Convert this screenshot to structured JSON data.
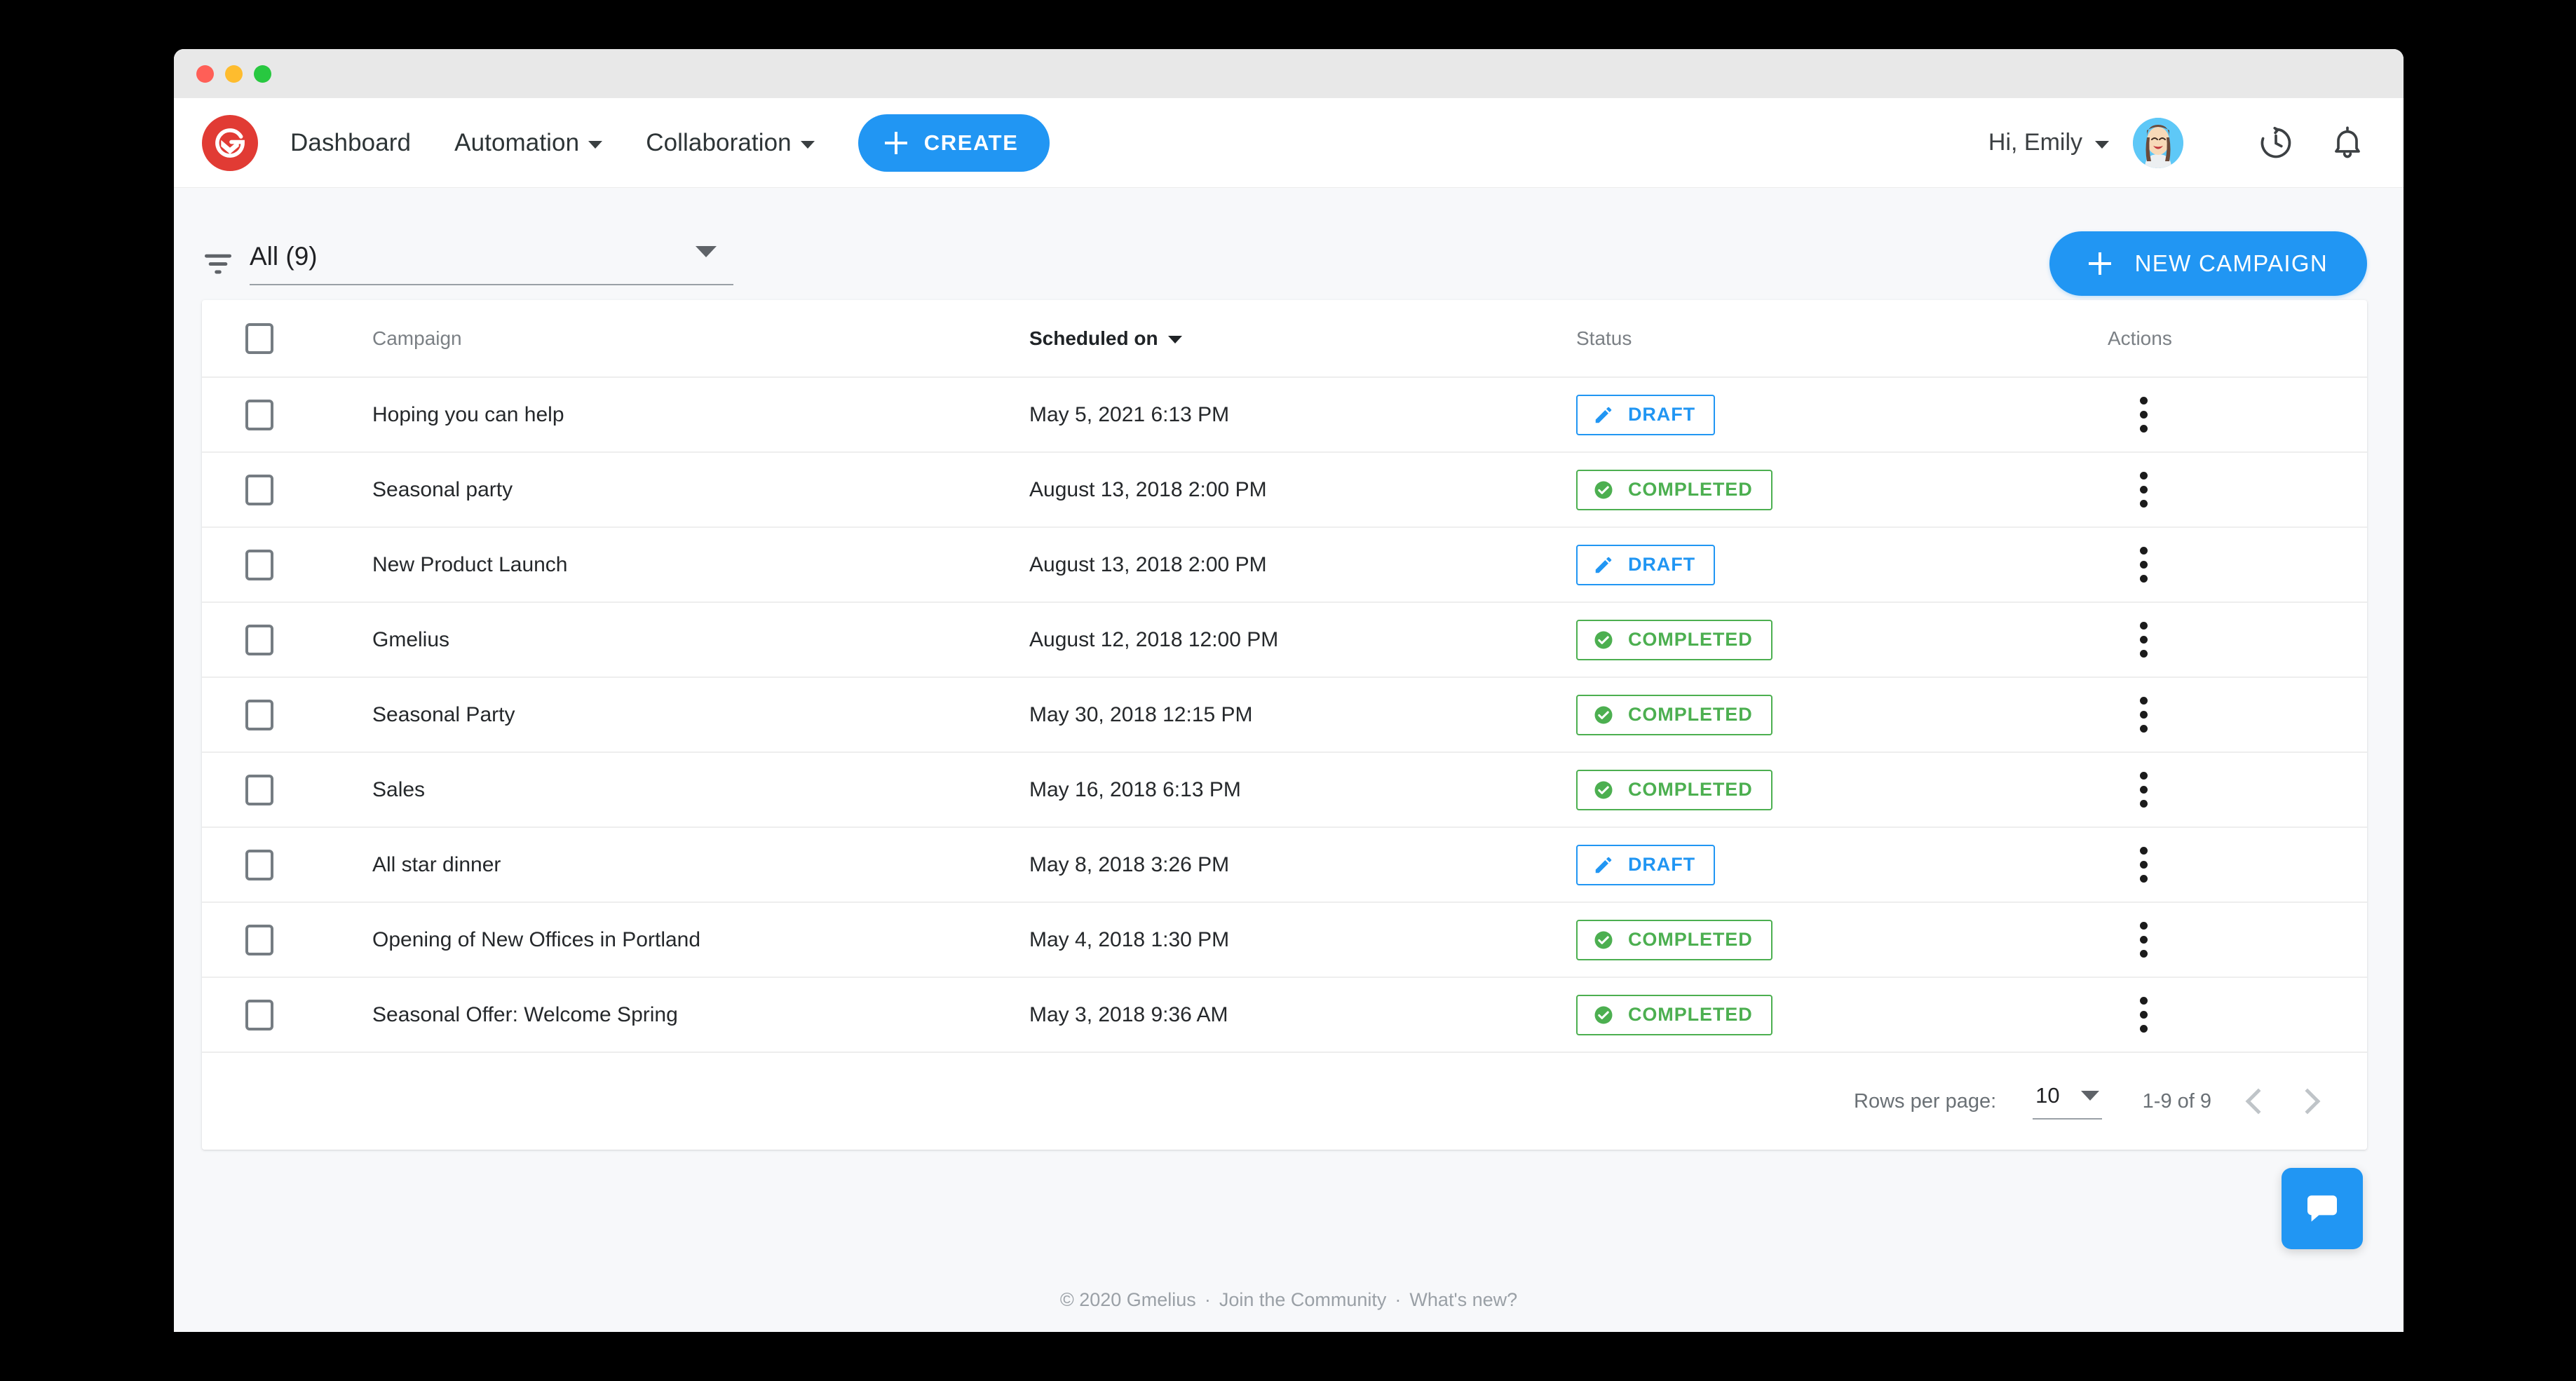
{
  "window": {
    "traffic_lights": [
      "close",
      "minimize",
      "maximize"
    ]
  },
  "navbar": {
    "logo_name": "gmelius-logo",
    "links": [
      {
        "label": "Dashboard",
        "has_dropdown": false
      },
      {
        "label": "Automation",
        "has_dropdown": true
      },
      {
        "label": "Collaboration",
        "has_dropdown": true
      }
    ],
    "create_button": "CREATE",
    "greeting": "Hi, Emily",
    "icons": [
      "history-icon",
      "bell-icon"
    ],
    "accent_blue": "#2196f3",
    "logo_red": "#e13b34"
  },
  "toolbar": {
    "filter_icon": "filter-icon",
    "filter_value": "All (9)",
    "new_campaign_button": "NEW CAMPAIGN"
  },
  "table": {
    "headers": {
      "checkbox": "",
      "campaign": "Campaign",
      "scheduled_on": "Scheduled on",
      "status": "Status",
      "actions": "Actions"
    },
    "sorted_column": "Scheduled on",
    "rows": [
      {
        "campaign": "Hoping you can help",
        "scheduled_on": "May 5, 2021 6:13 PM",
        "status": "DRAFT"
      },
      {
        "campaign": "Seasonal party",
        "scheduled_on": "August 13, 2018 2:00 PM",
        "status": "COMPLETED"
      },
      {
        "campaign": "New Product Launch",
        "scheduled_on": "August 13, 2018 2:00 PM",
        "status": "DRAFT"
      },
      {
        "campaign": "Gmelius",
        "scheduled_on": "August 12, 2018 12:00 PM",
        "status": "COMPLETED"
      },
      {
        "campaign": "Seasonal Party",
        "scheduled_on": "May 30, 2018 12:15 PM",
        "status": "COMPLETED"
      },
      {
        "campaign": "Sales",
        "scheduled_on": "May 16, 2018 6:13 PM",
        "status": "COMPLETED"
      },
      {
        "campaign": "All star dinner",
        "scheduled_on": "May 8, 2018 3:26 PM",
        "status": "DRAFT"
      },
      {
        "campaign": "Opening of New Offices in Portland",
        "scheduled_on": "May 4, 2018 1:30 PM",
        "status": "COMPLETED"
      },
      {
        "campaign": "Seasonal Offer: Welcome Spring",
        "scheduled_on": "May 3, 2018 9:36 AM",
        "status": "COMPLETED"
      }
    ],
    "status_colors": {
      "DRAFT": "#2196f3",
      "COMPLETED": "#4caf50"
    }
  },
  "pagination": {
    "rows_per_page_label": "Rows per page:",
    "rows_per_page_value": "10",
    "range_label": "1-9 of 9"
  },
  "chat": {
    "icon": "chat-bubble-icon"
  },
  "footer": {
    "copyright": "© 2020 Gmelius",
    "community_link": "Join the Community",
    "whats_new_link": "What's new?",
    "separator": "·"
  }
}
